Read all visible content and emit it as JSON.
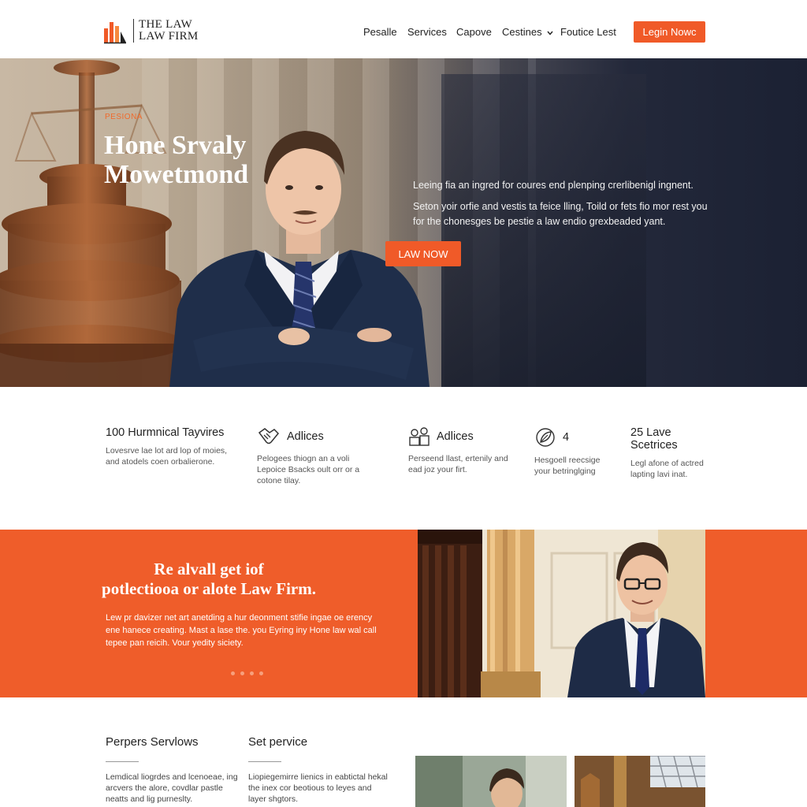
{
  "header": {
    "logo_line1": "THE LAW",
    "logo_line2": "LAW FIRM",
    "nav": [
      "Pesalle",
      "Services",
      "Capove",
      "Cestines",
      "Foutice Lest"
    ],
    "nav_dropdown_icon": "chevron-down-icon",
    "login_label": "Legin Nowc"
  },
  "hero": {
    "kicker": "PESIONA",
    "title": "Hone Srvaly Mowetmond",
    "copy1": "Leeing fia an ingred for coures end plenping crerlibenigl ingnent.",
    "copy2": "Seton yoir orfie and vestis ta feice lling, Toild or fets fio mor rest you for the chonesges be pestie a law endio grexbeaded yant.",
    "cta_label": "LAW NOW"
  },
  "features": [
    {
      "title": "100 Hurmnical Tayvires",
      "icon": "",
      "desc": "Lovesrve lae lot ard lop of moies, and atodels coen orbalierone."
    },
    {
      "title": "Adlices",
      "icon": "handshake-icon",
      "desc": "Pelogees thiogn an a voli Lepoice Bsacks oult orr or a cotone tilay."
    },
    {
      "title": "Adlices",
      "icon": "people-icon",
      "desc": "Perseend llast, ertenily and ead joz your firt."
    },
    {
      "title": "4",
      "icon": "leaf-icon",
      "desc": "Hesgoell reecsige your betringlging"
    },
    {
      "title": "25 Lave Scetrices",
      "icon": "",
      "desc": "Legl afone of actred lapting lavi inat."
    }
  ],
  "band": {
    "title_line1": "Re alvall get iof",
    "title_line2": "potlectiooa or alote Law Firm.",
    "copy": "Lew pr davizer net art anetding a hur deonment stifie ingae oe erency ene hanece creating. Mast a lase the. you Eyring iny Hone law wal call tepee pan reicih. Vour yedity siciety.",
    "carousel_dots": 4
  },
  "bottom": {
    "col1_title": "Perpers Servlows",
    "col1_desc": "Lemdical liogrdes and lcenoeae, ing arcvers the alore, covdlar pastle neatts and lig purneslty.",
    "col2_title": "Set pervice",
    "col2_desc": "Liopiegemirre lienics in eabtictal hekal the inex cor beotious to leyes and layer shgtors."
  },
  "colors": {
    "accent": "#f05a28",
    "hero_dark": "#1b2133",
    "band": "#ef5d2a"
  }
}
